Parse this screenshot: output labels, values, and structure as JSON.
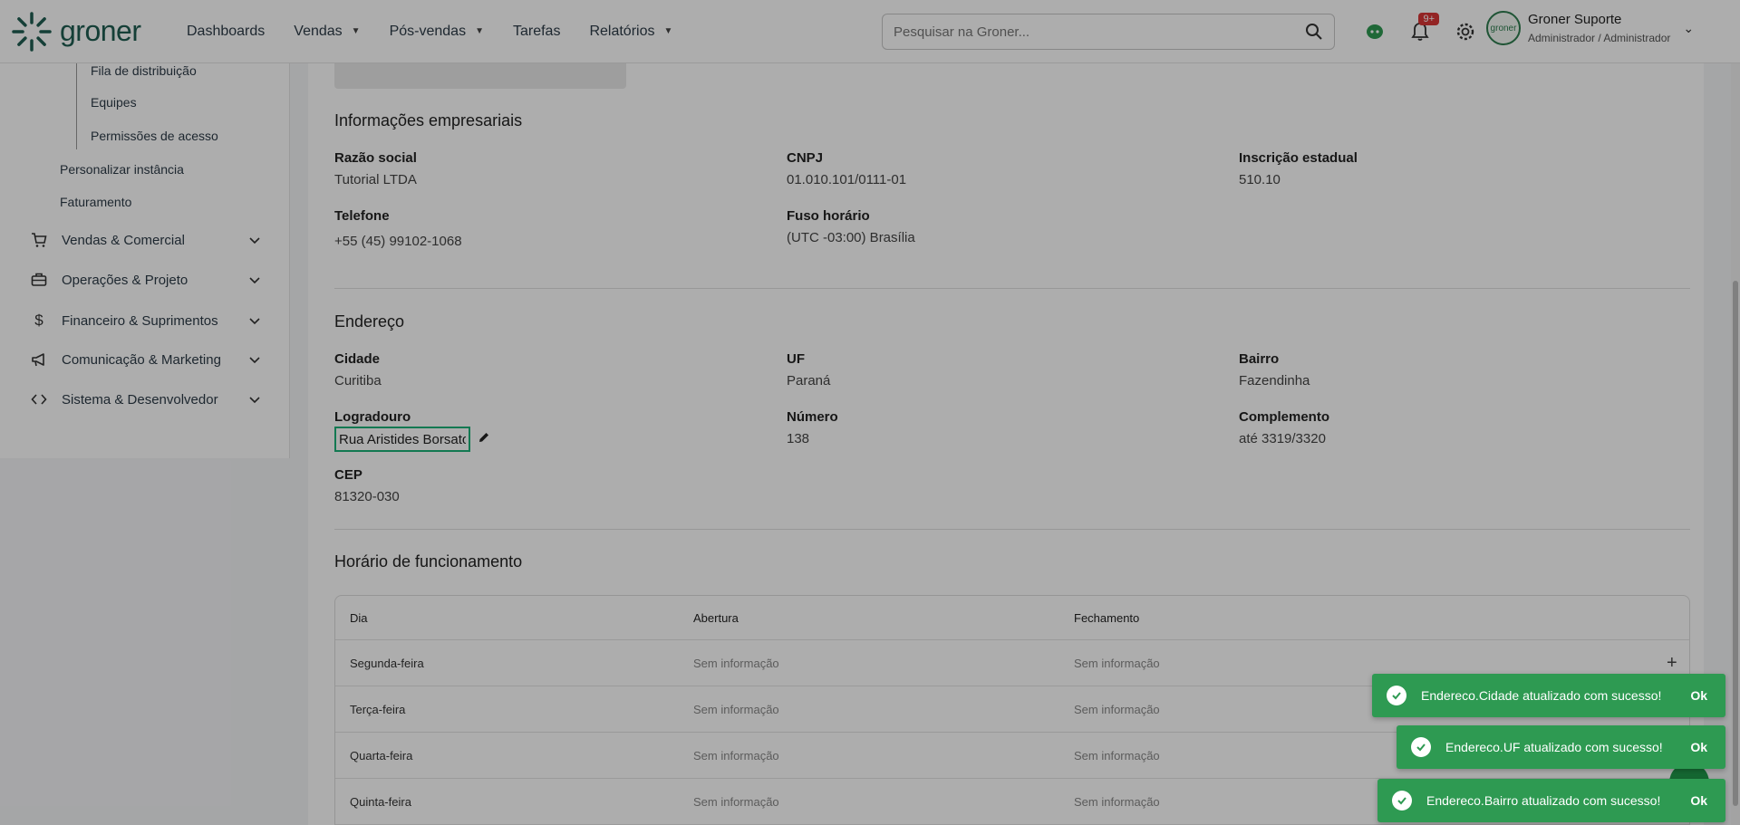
{
  "logo": {
    "text": "groner",
    "icon": "groner-sunburst-logo"
  },
  "nav": [
    {
      "label": "Dashboards",
      "has_caret": false
    },
    {
      "label": "Vendas",
      "has_caret": true
    },
    {
      "label": "Pós-vendas",
      "has_caret": true
    },
    {
      "label": "Tarefas",
      "has_caret": false
    },
    {
      "label": "Relatórios",
      "has_caret": true
    }
  ],
  "search": {
    "placeholder": "Pesquisar na Groner..."
  },
  "header_icons": {
    "notifications_badge": "9+"
  },
  "user": {
    "name": "Groner Suporte",
    "role": "Administrador / Administrador",
    "avatar_text": "groner"
  },
  "sidebar": {
    "sub_items": [
      "Fila de distribuição",
      "Equipes",
      "Permissões de acesso"
    ],
    "items": [
      "Personalizar instância",
      "Faturamento"
    ],
    "groups": [
      {
        "label": "Vendas & Comercial",
        "icon": "cart-icon"
      },
      {
        "label": "Operações & Projeto",
        "icon": "briefcase-icon"
      },
      {
        "label": "Financeiro & Suprimentos",
        "icon": "dollar-icon"
      },
      {
        "label": "Comunicação & Marketing",
        "icon": "megaphone-icon"
      },
      {
        "label": "Sistema & Desenvolvedor",
        "icon": "code-icon"
      }
    ]
  },
  "business": {
    "title": "Informações empresariais",
    "razao_label": "Razão social",
    "razao_value": "Tutorial LTDA",
    "cnpj_label": "CNPJ",
    "cnpj_value": "01.010.101/0111-01",
    "ie_label": "Inscrição estadual",
    "ie_value": "510.10",
    "telefone_label": "Telefone",
    "telefone_value": "+55 (45) 99102-1068",
    "fuso_label": "Fuso horário",
    "fuso_value": "(UTC -03:00) Brasília"
  },
  "address": {
    "title": "Endereço",
    "cidade_label": "Cidade",
    "cidade_value": "Curitiba",
    "uf_label": "UF",
    "uf_value": "Paraná",
    "bairro_label": "Bairro",
    "bairro_value": "Fazendinha",
    "logradouro_label": "Logradouro",
    "logradouro_value": "Rua Aristides Borsato",
    "numero_label": "Número",
    "numero_value": "138",
    "complemento_label": "Complemento",
    "complemento_value": "até 3319/3320",
    "cep_label": "CEP",
    "cep_value": "81320-030"
  },
  "hours": {
    "title": "Horário de funcionamento",
    "columns": [
      "Dia",
      "Abertura",
      "Fechamento"
    ],
    "rows": [
      {
        "day": "Segunda-feira",
        "open": "Sem informação",
        "close": "Sem informação"
      },
      {
        "day": "Terça-feira",
        "open": "Sem informação",
        "close": "Sem informação"
      },
      {
        "day": "Quarta-feira",
        "open": "Sem informação",
        "close": "Sem informação"
      },
      {
        "day": "Quinta-feira",
        "open": "Sem informação",
        "close": "Sem informação"
      }
    ]
  },
  "toasts": [
    {
      "message": "Endereco.Cidade atualizado com sucesso!",
      "action": "Ok"
    },
    {
      "message": "Endereco.UF atualizado com sucesso!",
      "action": "Ok"
    },
    {
      "message": "Endereco.Bairro atualizado com sucesso!",
      "action": "Ok"
    }
  ]
}
